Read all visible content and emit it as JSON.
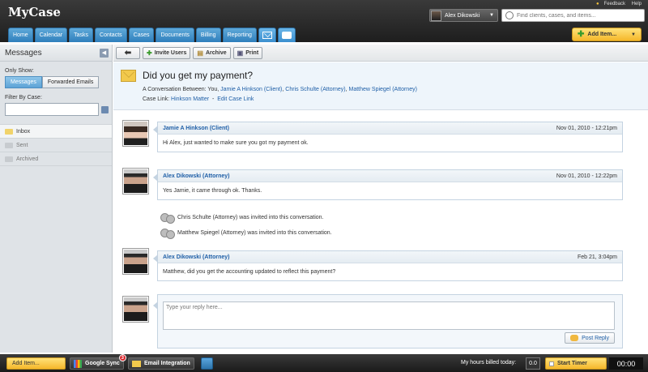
{
  "app": {
    "logo": "MyCase"
  },
  "toplinks": {
    "feedback": "Feedback",
    "help": "Help"
  },
  "user": {
    "name": "Alex Dikowski"
  },
  "search": {
    "placeholder": "Find clients, cases, and items..."
  },
  "nav": {
    "tabs": [
      "Home",
      "Calendar",
      "Tasks",
      "Contacts",
      "Cases",
      "Documents",
      "Billing",
      "Reporting"
    ],
    "active": "Messages"
  },
  "add_item": {
    "label": "Add Item..."
  },
  "sidebar": {
    "title": "Messages",
    "only_show_label": "Only Show:",
    "toggle": [
      "Messages",
      "Forwarded Emails"
    ],
    "filter_label": "Filter By Case:",
    "folders": [
      "Inbox",
      "Sent",
      "Archived"
    ],
    "selected_folder": "Inbox"
  },
  "toolbar": {
    "invite": "Invite Users",
    "archive": "Archive",
    "print": "Print"
  },
  "conversation": {
    "subject": "Did you get my payment?",
    "between_label": "A Conversation Between: You,",
    "participants": [
      "Jamie A Hinkson (Client)",
      "Chris Schulte (Attorney)",
      "Matthew Spiegel (Attorney)"
    ],
    "case_label": "Case Link:",
    "case_name": "Hinkson Matter",
    "edit_case_link": "Edit Case Link"
  },
  "messages": [
    {
      "author": "Jamie A Hinkson (Client)",
      "date": "Nov 01, 2010 - 12:21pm",
      "body": "Hi Alex, just wanted to make sure you got my payment ok."
    },
    {
      "author": "Alex Dikowski (Attorney)",
      "date": "Nov 01, 2010 - 12:22pm",
      "body": "Yes Jamie, it came through ok. Thanks."
    },
    {
      "author": "Alex Dikowski (Attorney)",
      "date": "Feb 21, 3:04pm",
      "body": "Matthew, did you get the accounting updated to reflect this payment?"
    }
  ],
  "invites": [
    "Chris Schulte (Attorney) was invited into this conversation.",
    "Matthew Spiegel (Attorney) was invited into this conversation."
  ],
  "reply": {
    "placeholder": "Type your reply here...",
    "post_label": "Post Reply"
  },
  "bottom": {
    "add_item": "Add Item...",
    "google_sync": "Google Sync",
    "google_sync_badge": "3",
    "email_integration": "Email Integration",
    "hours_label": "My hours billed today:",
    "hours_value": "0.0",
    "start_timer": "Start Timer",
    "timer_value": "00:00"
  }
}
